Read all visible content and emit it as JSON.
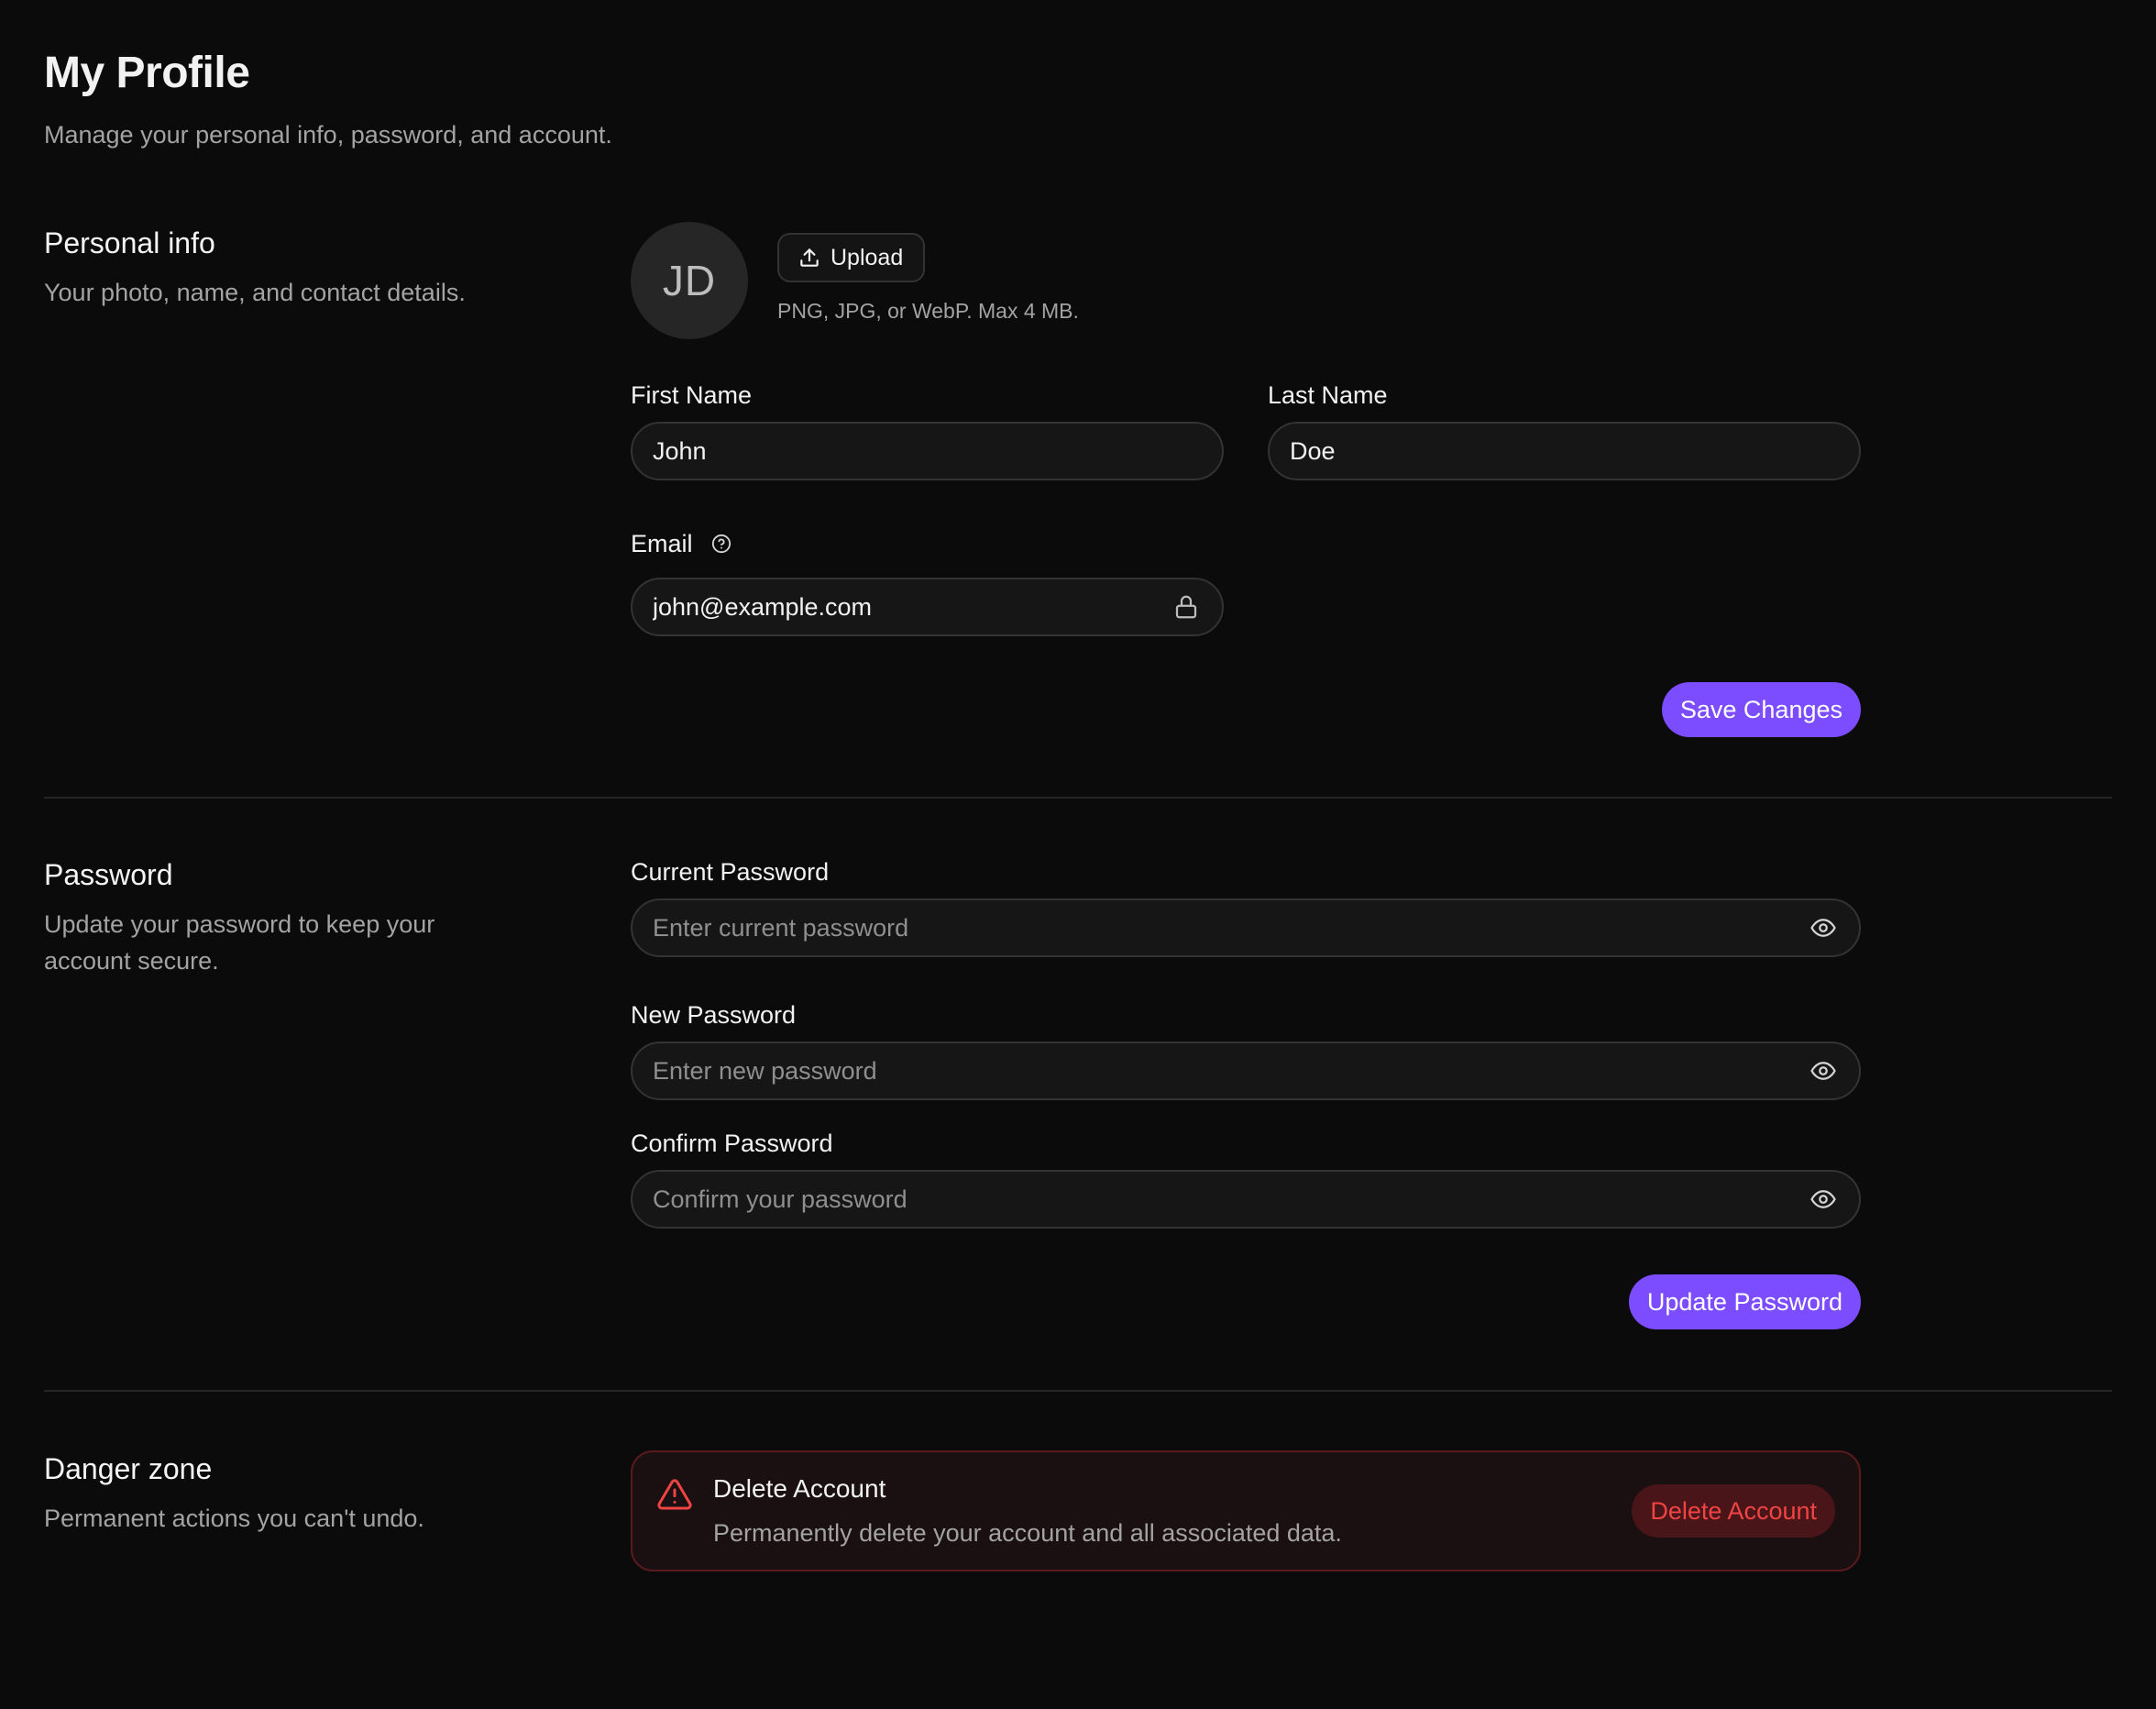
{
  "header": {
    "title": "My Profile",
    "subtitle": "Manage your personal info, password, and account."
  },
  "personal": {
    "title": "Personal info",
    "description": "Your photo, name, and contact details.",
    "avatar_initials": "JD",
    "upload_label": "Upload",
    "upload_hint": "PNG, JPG, or WebP. Max 4 MB.",
    "first_name_label": "First Name",
    "first_name_value": "John",
    "last_name_label": "Last Name",
    "last_name_value": "Doe",
    "email_label": "Email",
    "email_value": "john@example.com",
    "save_label": "Save Changes"
  },
  "password": {
    "title": "Password",
    "description": "Update your password to keep your account secure.",
    "current_label": "Current Password",
    "current_placeholder": "Enter current password",
    "new_label": "New Password",
    "new_placeholder": "Enter new password",
    "confirm_label": "Confirm Password",
    "confirm_placeholder": "Confirm your password",
    "update_label": "Update Password"
  },
  "danger": {
    "title": "Danger zone",
    "description": "Permanent actions you can't undo.",
    "card_title": "Delete Account",
    "card_description": "Permanently delete your account and all associated data.",
    "delete_label": "Delete Account"
  },
  "icons": {
    "upload": "upload-icon",
    "help": "help-circle-icon",
    "lock": "lock-icon",
    "eye": "eye-icon",
    "warning": "warning-triangle-icon"
  },
  "colors": {
    "background": "#0b0b0b",
    "accent": "#7c4dff",
    "danger": "#ef4444",
    "danger_bg": "#1a1011",
    "danger_border": "#5a1a1d"
  }
}
